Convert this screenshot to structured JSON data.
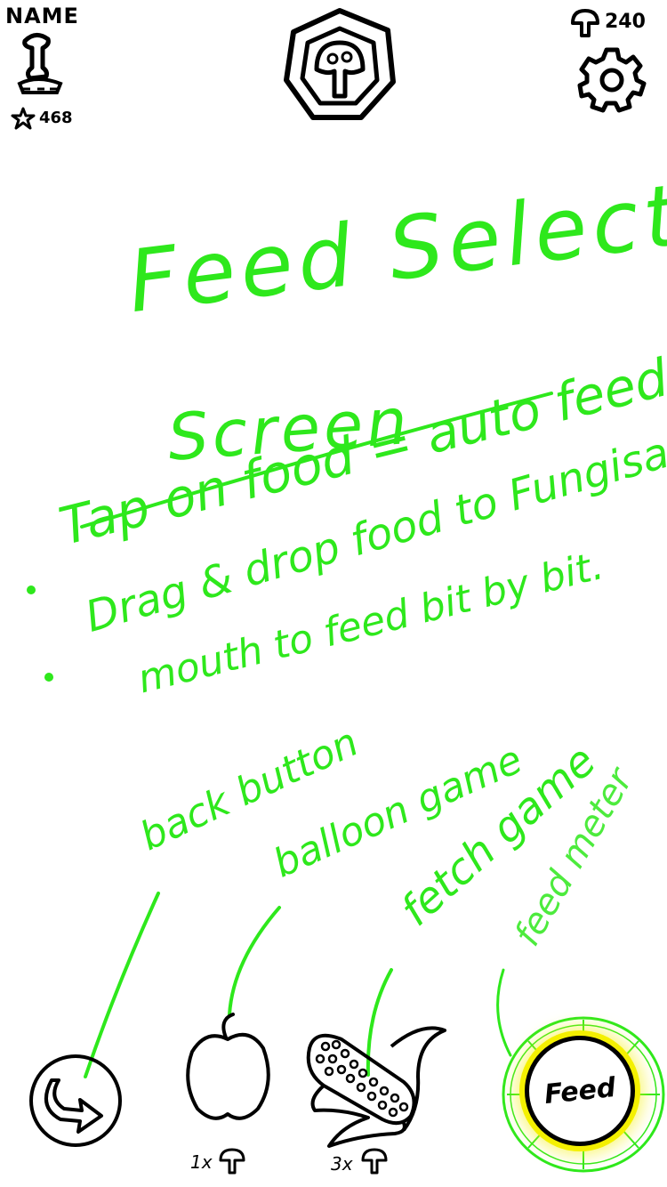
{
  "header": {
    "player_name": "NAME",
    "star_count": "468",
    "mushroom_currency": "240",
    "icons": {
      "avatar": "fungisaur-avatar-icon",
      "star": "star-icon",
      "emblem": "mushroom-emblem-icon",
      "currency": "mushroom-icon",
      "settings": "gear-icon"
    }
  },
  "annotations": {
    "title_line1": "Feed Select",
    "title_line2": "Screen",
    "bullet1": "Tap on food = auto feed",
    "bullet2_line1": "Drag & drop food to Fungisaur",
    "bullet2_line2": "mouth  to feed bit by bit.",
    "back_label": "back button",
    "balloon_label": "balloon game",
    "fetch_label": "fetch game",
    "meter_label": "feed meter"
  },
  "bottom_bar": {
    "apple_cost": "1x",
    "corn_cost": "3x",
    "feed_label": "Feed",
    "icons": {
      "back": "back-arrow-icon",
      "apple": "apple-icon",
      "corn": "corn-icon",
      "cost": "mushroom-icon"
    }
  },
  "colors": {
    "annotation": "#2ee81c",
    "feed_glow": "#f4f000",
    "ink": "#000000"
  }
}
